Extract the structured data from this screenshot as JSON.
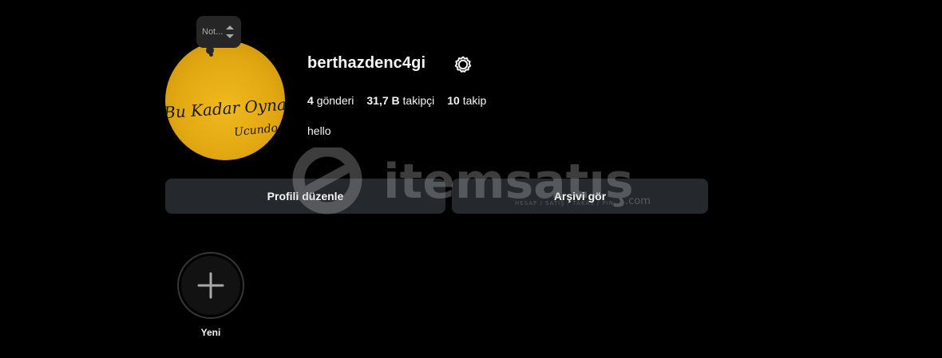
{
  "profile": {
    "username": "berthazdenc4gi",
    "note": "Not...",
    "bio": "hello",
    "avatar_text": [
      "Bu Kadar Oynamay",
      "Ucundo"
    ],
    "stats": {
      "posts_count": "4",
      "posts_label": "gönderi",
      "followers_count": "31,7 B",
      "followers_label": "takipçi",
      "following_count": "10",
      "following_label": "takip"
    }
  },
  "actions": {
    "edit_profile": "Profili düzenle",
    "view_archive": "Arşivi gör"
  },
  "highlights": {
    "new_label": "Yeni"
  },
  "watermark": {
    "brand": "itemsatış",
    "tagline": "HESAP / SATIŞ / TAKAS / PIN",
    "domain": ".com"
  },
  "icons": {
    "settings": "gear-icon",
    "plus": "plus-icon",
    "stepper": "up-down-stepper-icon"
  },
  "colors": {
    "background": "#000000",
    "button": "#25292e",
    "text": "#f5f5f5",
    "avatar": "#e2a812"
  }
}
